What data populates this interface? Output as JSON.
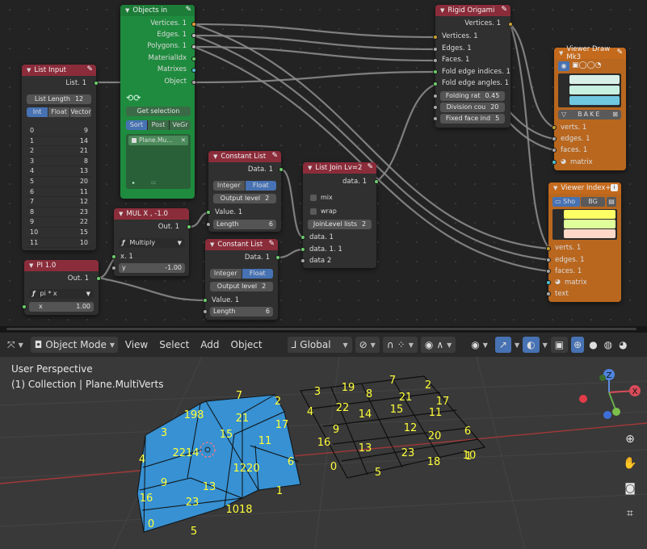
{
  "node_editor": {
    "objects_in": {
      "title": "Objects in",
      "outputs": [
        "Vertices. 1",
        "Edges. 1",
        "Polygons. 1",
        "MaterialIdx",
        "Matrixes",
        "Object"
      ],
      "get_selection_label": "Get selection",
      "sort_buttons": [
        "Sort",
        "Post",
        "VeGr"
      ],
      "object_item": "Plane.Mu...",
      "footer_dots": ":::"
    },
    "list_input": {
      "title": "List Input",
      "output": "List. 1",
      "list_length_label": "List Length",
      "list_length_value": "12",
      "modes": [
        "Int",
        "Float",
        "Vector"
      ],
      "rows": [
        [
          "0",
          "9"
        ],
        [
          "1",
          "14"
        ],
        [
          "2",
          "21"
        ],
        [
          "3",
          "8"
        ],
        [
          "4",
          "13"
        ],
        [
          "5",
          "20"
        ],
        [
          "6",
          "11"
        ],
        [
          "7",
          "12"
        ],
        [
          "8",
          "23"
        ],
        [
          "9",
          "22"
        ],
        [
          "10",
          "15"
        ],
        [
          "11",
          "10"
        ]
      ]
    },
    "constant_list_1": {
      "title": "Constant List",
      "output": "Data. 1",
      "types": [
        "Integer",
        "Float"
      ],
      "output_level_label": "Output level",
      "output_level_value": "2",
      "input_value": "Value. 1",
      "length_label": "Length",
      "length_value": "6"
    },
    "constant_list_2": {
      "title": "Constant List",
      "output": "Data. 1",
      "types": [
        "Integer",
        "Float"
      ],
      "output_level_label": "Output level",
      "output_level_value": "2",
      "input_value": "Value. 1",
      "length_label": "Length",
      "length_value": "6"
    },
    "mul": {
      "title": "MUL X , -1.0",
      "output": "Out. 1",
      "operation": "Multiply",
      "input_x": "x. 1",
      "input_y_label": "y",
      "input_y_value": "-1.00"
    },
    "pi": {
      "title": "PI 1.0",
      "output": "Out. 1",
      "expression": "pi * x",
      "x_label": "x",
      "x_value": "1.00"
    },
    "list_join": {
      "title": "List Join Lv=2",
      "output": "data. 1",
      "mix_label": "mix",
      "wrap_label": "wrap",
      "join_level_label": "JoinLevel lists",
      "join_level_value": "2",
      "inputs": [
        "data. 1",
        "data. 1. 1",
        "data 2"
      ]
    },
    "rigid_origami": {
      "title": "Rigid Origami",
      "output": "Vertices. 1",
      "inputs": [
        "Vertices. 1",
        "Edges. 1",
        "Faces. 1",
        "Fold edge indices. 1",
        "Fold edge angles. 1"
      ],
      "folding_rat_label": "Folding rat",
      "folding_rat_value": "0.45",
      "division_label": "Division cou",
      "division_value": "20",
      "fixed_face_label": "Fixed face ind",
      "fixed_face_value": "5"
    },
    "viewer_draw": {
      "title": "Viewer Draw Mk3",
      "bake_label": "BAKE",
      "inputs": [
        "verts. 1",
        "edges. 1",
        "faces. 1",
        "matrix"
      ]
    },
    "viewer_index": {
      "title": "Viewer Index+",
      "tabs": [
        "Sho",
        "BG"
      ],
      "inputs": [
        "verts. 1",
        "edges. 1",
        "faces. 1",
        "matrix",
        "text"
      ]
    }
  },
  "viewport_header": {
    "mode": "Object Mode",
    "menus": [
      "View",
      "Select",
      "Add",
      "Object"
    ],
    "transform_orientation": "Global"
  },
  "viewport": {
    "perspective_label": "User Perspective",
    "collection_label": "(1) Collection | Plane.MultiVerts",
    "gizmo_axes": [
      "Z",
      "X"
    ],
    "left_mesh_labels": [
      {
        "t": "7"
      },
      {
        "t": "2"
      },
      {
        "t": "198"
      },
      {
        "t": "21"
      },
      {
        "t": "17"
      },
      {
        "t": "3"
      },
      {
        "t": "15"
      },
      {
        "t": "11"
      },
      {
        "t": "2214"
      },
      {
        "t": "4"
      },
      {
        "t": "1220"
      },
      {
        "t": "6"
      },
      {
        "t": "9"
      },
      {
        "t": "13"
      },
      {
        "t": "1"
      },
      {
        "t": "16"
      },
      {
        "t": "23"
      },
      {
        "t": "1018"
      },
      {
        "t": "0"
      },
      {
        "t": "5"
      }
    ],
    "right_grid_labels": [
      {
        "t": "3"
      },
      {
        "t": "19"
      },
      {
        "t": "7"
      },
      {
        "t": "2"
      },
      {
        "t": "8"
      },
      {
        "t": "21"
      },
      {
        "t": "17"
      },
      {
        "t": "4"
      },
      {
        "t": "22"
      },
      {
        "t": "14"
      },
      {
        "t": "15"
      },
      {
        "t": "11"
      },
      {
        "t": "9"
      },
      {
        "t": "12"
      },
      {
        "t": "6"
      },
      {
        "t": "16"
      },
      {
        "t": "13"
      },
      {
        "t": "20"
      },
      {
        "t": "23"
      },
      {
        "t": "10"
      },
      {
        "t": "1"
      },
      {
        "t": "0"
      },
      {
        "t": "18"
      },
      {
        "t": "5"
      }
    ]
  }
}
